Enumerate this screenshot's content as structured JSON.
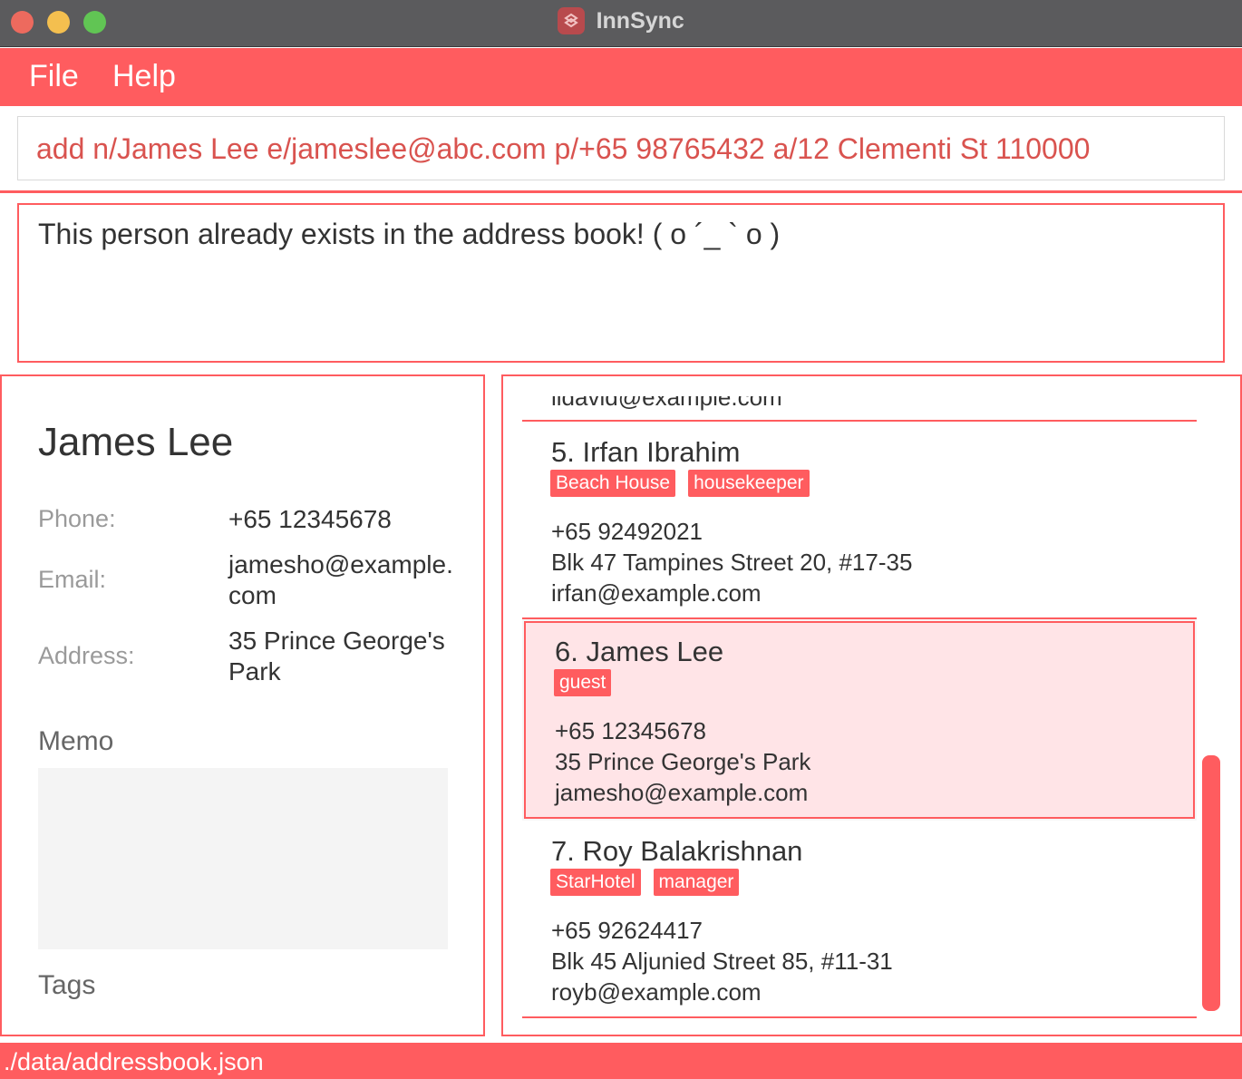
{
  "window": {
    "title": "InnSync"
  },
  "menu": {
    "file": "File",
    "help": "Help"
  },
  "command": {
    "value": "add n/James Lee e/jameslee@abc.com p/+65 98765432 a/12 Clementi St 110000"
  },
  "result": {
    "message": "This person already exists in the address book! ( o ´_ ` o )"
  },
  "detail": {
    "name": "James Lee",
    "phone_label": "Phone:",
    "phone": "+65 12345678",
    "email_label": "Email:",
    "email": "jamesho@example.com",
    "address_label": "Address:",
    "address": "35 Prince George's Park",
    "memo_title": "Memo",
    "tags_title": "Tags"
  },
  "list": {
    "partial_top": "lidavid@example.com",
    "items": [
      {
        "title": "5.  Irfan Ibrahim",
        "tags": [
          "Beach House",
          "housekeeper"
        ],
        "phone": "+65 92492021",
        "address": "Blk 47 Tampines Street 20, #17-35",
        "email": "irfan@example.com"
      },
      {
        "title": "6.  James Lee",
        "tags": [
          "guest"
        ],
        "phone": "+65 12345678",
        "address": "35 Prince George's Park",
        "email": "jamesho@example.com"
      },
      {
        "title": "7.  Roy Balakrishnan",
        "tags": [
          "StarHotel",
          "manager"
        ],
        "phone": "+65 92624417",
        "address": "Blk 45 Aljunied Street 85, #11-31",
        "email": "royb@example.com"
      }
    ]
  },
  "status": {
    "path": "./data/addressbook.json"
  },
  "colors": {
    "accent": "#ff5c5f",
    "selected_bg": "#ffe4e7",
    "command_text": "#d9534f"
  }
}
